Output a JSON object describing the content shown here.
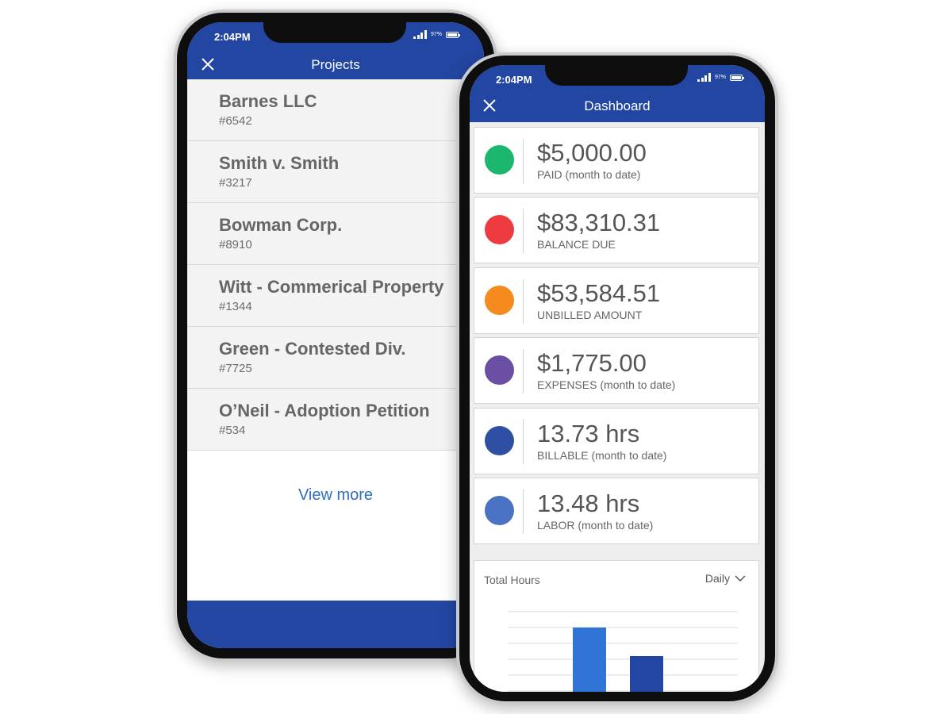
{
  "status": {
    "time": "2:04PM",
    "battery_pct": "97%"
  },
  "projects_screen": {
    "title": "Projects",
    "projects": [
      {
        "name": "Barnes LLC",
        "number": "#6542"
      },
      {
        "name": "Smith v. Smith",
        "number": "#3217"
      },
      {
        "name": "Bowman Corp.",
        "number": "#8910"
      },
      {
        "name": "Witt - Commerical Property",
        "number": "#1344"
      },
      {
        "name": "Green - Contested Div.",
        "number": "#7725"
      },
      {
        "name": "O’Neil - Adoption Petition",
        "number": "#534"
      }
    ],
    "view_more_label": "View more"
  },
  "dashboard_screen": {
    "title": "Dashboard",
    "metrics": [
      {
        "value": "$5,000.00",
        "label": "PAID",
        "qualifier": " (month to date)",
        "color": "#1bb76e"
      },
      {
        "value": "$83,310.31",
        "label": "BALANCE DUE",
        "qualifier": "",
        "color": "#ee3b3f"
      },
      {
        "value": "$53,584.51",
        "label": "UNBILLED AMOUNT",
        "qualifier": "",
        "color": "#f58a1f"
      },
      {
        "value": "$1,775.00",
        "label": "EXPENSES",
        "qualifier": " (month to date)",
        "color": "#6a4fa3"
      },
      {
        "value": "13.73 hrs",
        "label": "BILLABLE",
        "qualifier": " (month to date)",
        "color": "#2e4fa2"
      },
      {
        "value": "13.48 hrs",
        "label": "LABOR",
        "qualifier": " (month to date)",
        "color": "#4a73c4"
      }
    ],
    "hours_title": "Total Hours",
    "period_selected": "Daily"
  },
  "colors": {
    "header_blue": "#2346a2",
    "bar_light_blue": "#2f74d6",
    "bar_dark_blue": "#2346a2",
    "link_blue": "#2d6fc0"
  },
  "chart_data": {
    "type": "bar",
    "title": "Total Hours",
    "categories": [
      "",
      ""
    ],
    "values": [
      5,
      3.2
    ],
    "ylim": [
      0,
      6
    ],
    "grid": true,
    "colors": [
      "#2f74d6",
      "#2346a2"
    ]
  }
}
